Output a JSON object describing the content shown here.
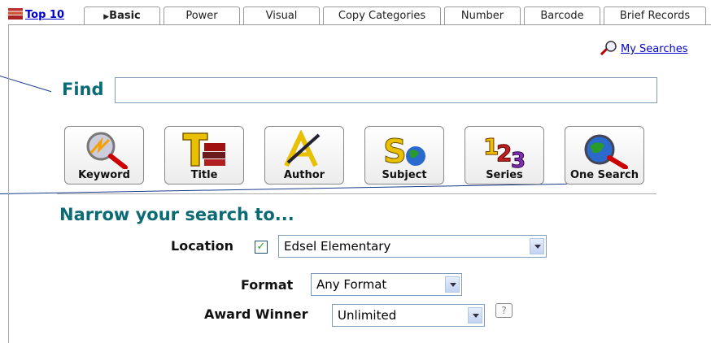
{
  "tabs": {
    "top10": "Top 10",
    "basic": "Basic",
    "power": "Power",
    "visual": "Visual",
    "copy_categories": "Copy Categories",
    "number": "Number",
    "barcode": "Barcode",
    "brief_records": "Brief Records"
  },
  "my_searches": "My Searches",
  "find": {
    "label": "Find",
    "value": ""
  },
  "search_buttons": {
    "keyword": "Keyword",
    "title": "Title",
    "author": "Author",
    "subject": "Subject",
    "series": "Series",
    "one_search": "One Search"
  },
  "narrow": {
    "heading": "Narrow your search to...",
    "location_label": "Location",
    "location_checked": true,
    "location_value": "Edsel Elementary",
    "format_label": "Format",
    "format_value": "Any Format",
    "award_label": "Award Winner",
    "award_value": "Unlimited",
    "help_glyph": "?"
  },
  "colors": {
    "heading": "#0b6b74",
    "link": "#0000cc",
    "callout": "#1a3a8a"
  }
}
